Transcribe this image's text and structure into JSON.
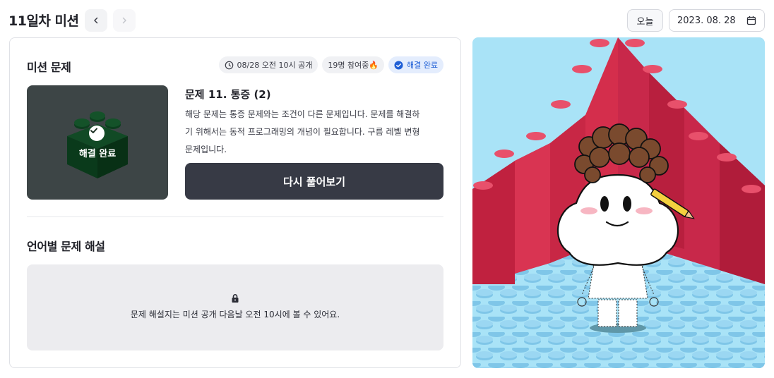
{
  "header": {
    "title": "11일차 미션",
    "today_label": "오늘",
    "date_value": "2023. 08. 28"
  },
  "mission": {
    "section_title": "미션 문제",
    "badges": {
      "release": "08/28 오전 10시 공개",
      "participants": "19명 참여중🔥",
      "status": "해결 완료"
    },
    "thumbnail_label": "해결 완료",
    "problem_title": "문제 11. 통증 (2)",
    "problem_desc_lines": [
      "해당 문제는 통증 문제와는 조건이 다른 문제입니다. 문제를 해결하",
      "기 위해서는 동적 프로그래밍의 개념이 필요합니다. 구름 레벨 변형",
      "문제입니다."
    ],
    "retry_button": "다시 풀어보기"
  },
  "explanations": {
    "section_title": "언어별 문제 해설",
    "locked_message": "문제 해설지는 미션 공개 다음날 오전 10시에 볼 수 있어요."
  },
  "icons": {
    "prev": "chevron-left-icon",
    "next": "chevron-right-icon",
    "calendar": "calendar-icon",
    "clock": "clock-icon",
    "check": "check-circle-icon",
    "lock": "lock-icon"
  },
  "colors": {
    "primary_button": "#373a45",
    "done_badge_bg": "#e4edfd",
    "done_badge_text": "#1f5fd6",
    "lego_red": "#e1314f",
    "lego_blue": "#a9e3f7",
    "thumbnail_bg": "#3d4546",
    "lego_green": "#0f3f1f"
  }
}
